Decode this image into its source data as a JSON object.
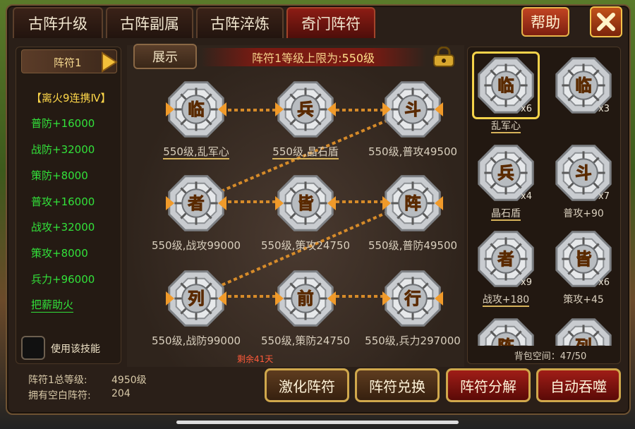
{
  "tabs": [
    "古阵升级",
    "古阵副属",
    "古阵淬炼",
    "奇门阵符"
  ],
  "active_tab": 3,
  "help_label": "帮助",
  "left": {
    "skill_name": "阵符1",
    "combo": "【离火9连携Ⅳ】",
    "stats": [
      "普防+16000",
      "战防+32000",
      "策防+8000",
      "普攻+16000",
      "战攻+32000",
      "策攻+8000",
      "兵力+96000"
    ],
    "skill_link": "把薪助火",
    "use_skill": "使用该技能"
  },
  "summary": {
    "total_label": "阵符1总等级:",
    "total_value": "4950级",
    "blank_label": "拥有空白阵符:",
    "blank_value": "204"
  },
  "center": {
    "show_button": "展示",
    "limit_text": "阵符1等级上限为:",
    "limit_value": "550级",
    "remaining": "剩余41天",
    "slots": [
      {
        "char": "临",
        "label": "550级,乱军心",
        "underline": true
      },
      {
        "char": "兵",
        "label": "550级,晶石盾",
        "underline": true
      },
      {
        "char": "斗",
        "label": "550级,普攻49500",
        "underline": false
      },
      {
        "char": "者",
        "label": "550级,战攻99000",
        "underline": false
      },
      {
        "char": "皆",
        "label": "550级,策攻24750",
        "underline": false
      },
      {
        "char": "阵",
        "label": "550级,普防49500",
        "underline": false
      },
      {
        "char": "列",
        "label": "550级,战防99000",
        "underline": false
      },
      {
        "char": "前",
        "label": "550级,策防24750",
        "underline": false
      },
      {
        "char": "行",
        "label": "550级,兵力297000",
        "underline": false
      }
    ]
  },
  "inventory": {
    "items": [
      {
        "char": "临",
        "count": "x6",
        "label": "乱军心",
        "selected": true
      },
      {
        "char": "临",
        "count": "x3",
        "label": "",
        "selected": false
      },
      {
        "char": "兵",
        "count": "x4",
        "label": "晶石盾",
        "selected": false
      },
      {
        "char": "斗",
        "count": "x7",
        "label": "普攻+90",
        "selected": false
      },
      {
        "char": "者",
        "count": "x9",
        "label": "战攻+180",
        "selected": false
      },
      {
        "char": "皆",
        "count": "x6",
        "label": "策攻+45",
        "selected": false
      },
      {
        "char": "阵",
        "count": "",
        "label": "",
        "selected": false
      },
      {
        "char": "列",
        "count": "",
        "label": "",
        "selected": false
      }
    ],
    "bag_space": "背包空间：47/50"
  },
  "buttons": [
    "激化阵符",
    "阵符兑换",
    "阵符分解",
    "自动吞噬"
  ],
  "colors": {
    "tab_active": "#8c1c14",
    "stat_green": "#32e13a",
    "gold": "#d0a84c",
    "remaining_red": "#ff5a3a"
  }
}
